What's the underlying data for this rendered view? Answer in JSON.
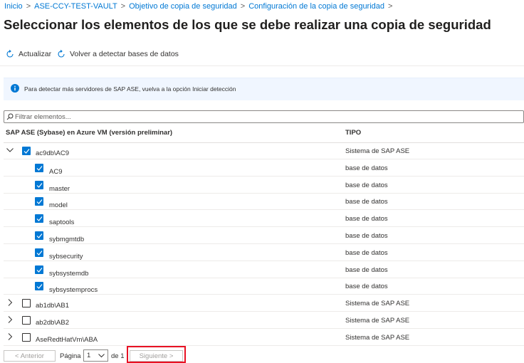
{
  "breadcrumb": {
    "items": [
      "Inicio",
      "ASE-CCY-TEST-VAULT",
      "Objetivo de copia de seguridad",
      "Configuración de la copia de seguridad"
    ],
    "separator": ">"
  },
  "page": {
    "title": "Seleccionar los elementos de los que se debe realizar una copia de seguridad",
    "more": "···"
  },
  "toolbar": {
    "refresh_label": "Actualizar",
    "rediscover_label": "Volver a detectar bases de datos"
  },
  "info": {
    "text": "Para detectar más servidores de SAP ASE, vuelva a la opción Iniciar detección"
  },
  "filter": {
    "placeholder": "Filtrar elementos..."
  },
  "table": {
    "columns": [
      "SAP ASE (Sybase) en Azure VM (versión preliminar)",
      "TIPO"
    ],
    "rows": [
      {
        "name": "ac9db\\AC9",
        "type": "Sistema de SAP ASE",
        "checked": true,
        "expanded": true,
        "level": 0
      },
      {
        "name": "AC9",
        "type": "base de datos",
        "checked": true,
        "level": 1
      },
      {
        "name": "master",
        "type": "base de datos",
        "checked": true,
        "level": 1
      },
      {
        "name": "model",
        "type": "base de datos",
        "checked": true,
        "level": 1
      },
      {
        "name": "saptools",
        "type": "base de datos",
        "checked": true,
        "level": 1
      },
      {
        "name": "sybmgmtdb",
        "type": "base de datos",
        "checked": true,
        "level": 1
      },
      {
        "name": "sybsecurity",
        "type": "base de datos",
        "checked": true,
        "level": 1
      },
      {
        "name": "sybsystemdb",
        "type": "base de datos",
        "checked": true,
        "level": 1
      },
      {
        "name": "sybsystemprocs",
        "type": "base de datos",
        "checked": true,
        "level": 1
      },
      {
        "name": "ab1db\\AB1",
        "type": "Sistema de SAP ASE",
        "checked": false,
        "expanded": false,
        "level": 0
      },
      {
        "name": "ab2db\\AB2",
        "type": "Sistema de SAP ASE",
        "checked": false,
        "expanded": false,
        "level": 0
      },
      {
        "name": "AseRedtHatVm\\ABA",
        "type": "Sistema de SAP ASE",
        "checked": false,
        "expanded": false,
        "level": 0
      }
    ]
  },
  "pagination": {
    "prev_label": "< Anterior",
    "page_label": "Página",
    "current_page": "1",
    "of_label": "de 1",
    "next_label": "Siguiente >"
  },
  "colors": {
    "accent": "#0078d4",
    "highlight": "#e81123"
  }
}
